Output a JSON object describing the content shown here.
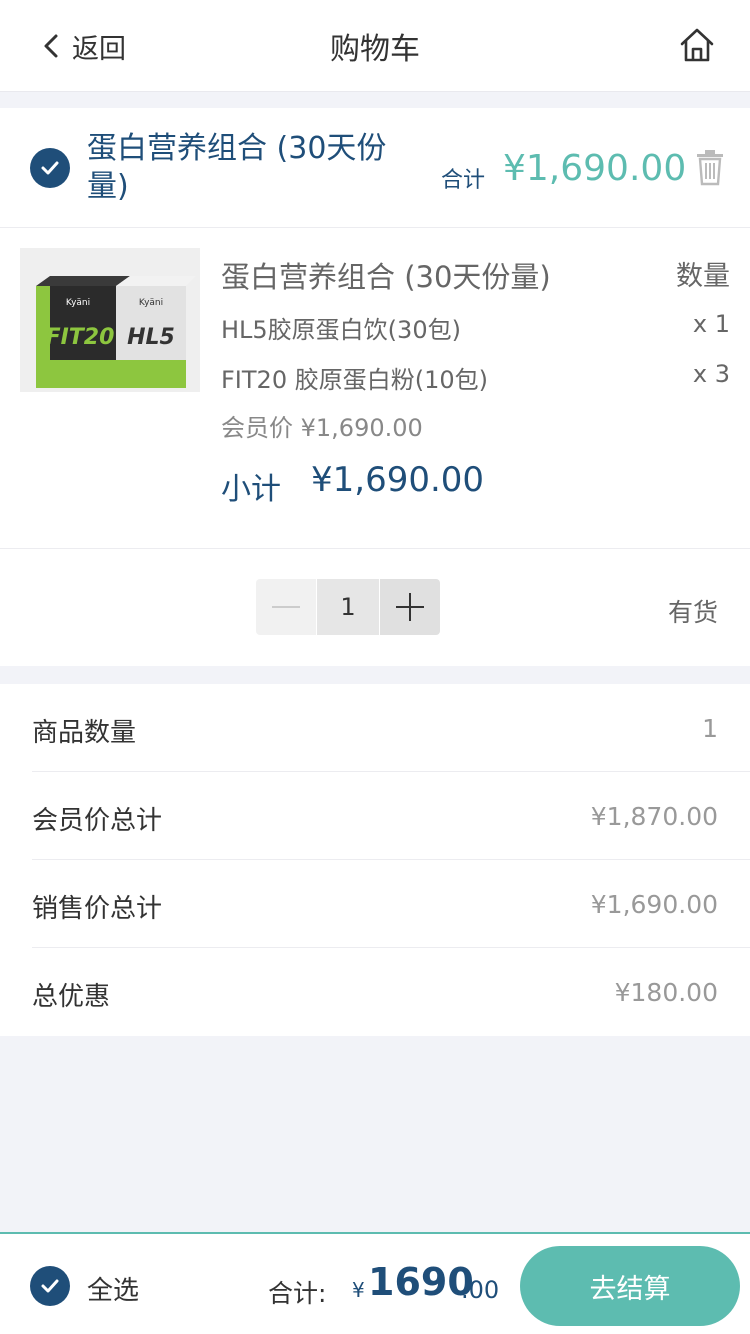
{
  "header": {
    "back_label": "返回",
    "title": "购物车"
  },
  "bundle": {
    "title": "蛋白营养组合 (30天份量)",
    "total_label": "合计",
    "total_value": "¥1,690.00",
    "selected": true,
    "product_name": "蛋白营养组合 (30天份量)",
    "quantity_header": "数量",
    "items": [
      {
        "name": "HL5胶原蛋白饮(30包)",
        "qty": "x 1"
      },
      {
        "name": "FIT20 胶原蛋白粉(10包)",
        "qty": "x 3"
      }
    ],
    "member_price": "会员价 ¥1,690.00",
    "subtotal_label": "小计",
    "subtotal_value": "¥1,690.00",
    "quantity": "1",
    "stock_status": "有货",
    "image_brands": [
      "Kyäni",
      "FIT20",
      "Kyäni",
      "HL5"
    ]
  },
  "summary": [
    {
      "label": "商品数量",
      "value": "1"
    },
    {
      "label": "会员价总计",
      "value": "¥1,870.00"
    },
    {
      "label": "销售价总计",
      "value": "¥1,690.00"
    },
    {
      "label": "总优惠",
      "value": "¥180.00"
    }
  ],
  "bottom": {
    "select_all_label": "全选",
    "total_label": "合计:",
    "currency": "¥",
    "amount_integer": "1690",
    "amount_decimal": ".00",
    "checkout_label": "去结算"
  },
  "colors": {
    "primary": "#1f4e79",
    "accent": "#5dbcb0",
    "background": "#f2f3f8"
  },
  "icons": [
    "chevron-left-icon",
    "home-icon",
    "checkmark-icon",
    "trash-icon",
    "minus-icon",
    "plus-icon"
  ]
}
